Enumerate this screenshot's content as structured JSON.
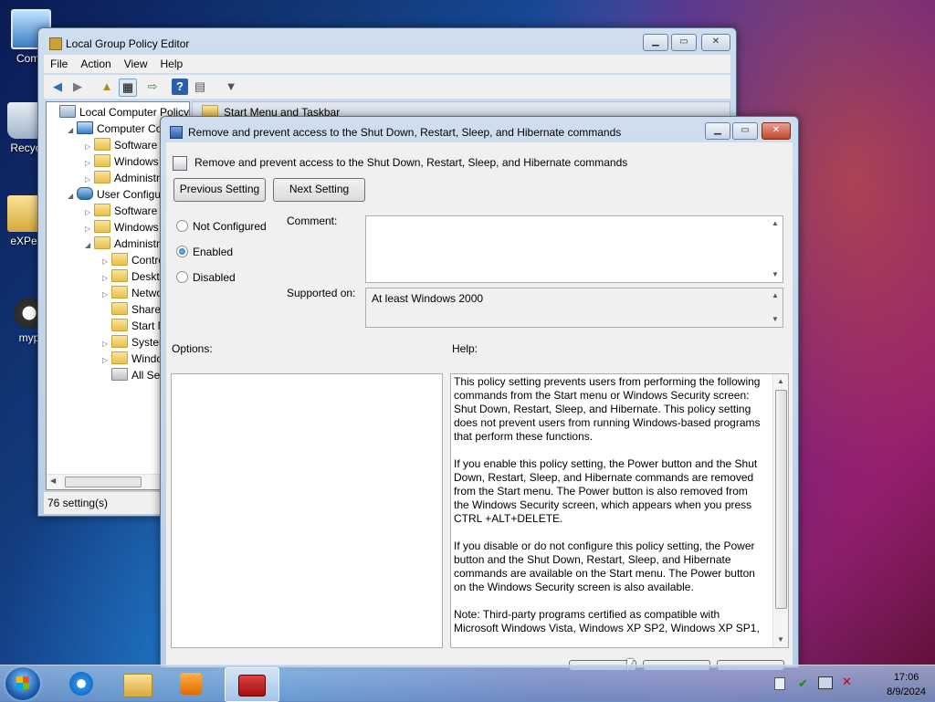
{
  "desktop": {
    "icons": [
      {
        "label": "Comp",
        "name": "computer"
      },
      {
        "label": "Recyc",
        "name": "recycle-bin"
      },
      {
        "label": "eXPer",
        "name": "folder"
      },
      {
        "label": "myp",
        "name": "program-shortcut"
      }
    ]
  },
  "gpedit": {
    "title": "Local Group Policy Editor",
    "menu": [
      "File",
      "Action",
      "View",
      "Help"
    ],
    "tree": [
      {
        "label": "Local Computer Policy",
        "indent": 0,
        "arrow": "",
        "icon": "policy"
      },
      {
        "label": "Computer Conf",
        "indent": 1,
        "arrow": "◢",
        "icon": "computer"
      },
      {
        "label": "Software Set",
        "indent": 2,
        "arrow": "▷",
        "icon": "folder"
      },
      {
        "label": "Windows Se",
        "indent": 2,
        "arrow": "▷",
        "icon": "folder"
      },
      {
        "label": "Administrat",
        "indent": 2,
        "arrow": "▷",
        "icon": "folder"
      },
      {
        "label": "User Configurat",
        "indent": 1,
        "arrow": "◢",
        "icon": "user"
      },
      {
        "label": "Software Set",
        "indent": 2,
        "arrow": "▷",
        "icon": "folder"
      },
      {
        "label": "Windows Se",
        "indent": 2,
        "arrow": "▷",
        "icon": "folder"
      },
      {
        "label": "Administrat",
        "indent": 2,
        "arrow": "◢",
        "icon": "folder"
      },
      {
        "label": "Control",
        "indent": 3,
        "arrow": "▷",
        "icon": "folder"
      },
      {
        "label": "Desktop",
        "indent": 3,
        "arrow": "▷",
        "icon": "folder"
      },
      {
        "label": "Network",
        "indent": 3,
        "arrow": "▷",
        "icon": "folder"
      },
      {
        "label": "Shared F",
        "indent": 3,
        "arrow": "",
        "icon": "folder"
      },
      {
        "label": "Start Me",
        "indent": 3,
        "arrow": "",
        "icon": "folder"
      },
      {
        "label": "System",
        "indent": 3,
        "arrow": "▷",
        "icon": "folder"
      },
      {
        "label": "Window",
        "indent": 3,
        "arrow": "▷",
        "icon": "folder"
      },
      {
        "label": "All Settin",
        "indent": 3,
        "arrow": "",
        "icon": "settings"
      }
    ],
    "right_header": "Start Menu and Taskbar",
    "status": "76 setting(s)"
  },
  "dialog": {
    "title": "Remove and prevent access to the Shut Down, Restart, Sleep, and Hibernate commands",
    "heading": "Remove and prevent access to the Shut Down, Restart, Sleep, and Hibernate commands",
    "prev_button": "Previous Setting",
    "next_button": "Next Setting",
    "radio_not_configured": "Not Configured",
    "radio_enabled": "Enabled",
    "radio_disabled": "Disabled",
    "selected": "Enabled",
    "comment_label": "Comment:",
    "comment_value": "",
    "supported_label": "Supported on:",
    "supported_value": "At least Windows 2000",
    "options_label": "Options:",
    "help_label": "Help:",
    "help_paragraphs": [
      "This policy setting prevents users from performing the following commands from the Start menu or Windows Security screen: Shut Down, Restart, Sleep, and Hibernate. This policy setting does not prevent users from running Windows-based programs that perform these functions.",
      "If you enable this policy setting, the Power button and the Shut Down, Restart, Sleep, and Hibernate commands are removed from the Start menu. The Power button is also removed from the Windows Security screen, which appears when you press CTRL +ALT+DELETE.",
      "If you disable or do not configure this policy setting, the Power button and the Shut Down, Restart, Sleep, and Hibernate commands are available on the Start menu. The Power button on the Windows Security screen is also available.",
      "Note: Third-party programs certified as compatible with Microsoft Windows Vista, Windows XP SP2, Windows XP SP1,"
    ]
  },
  "taskbar": {
    "apps": [
      "internet-explorer",
      "file-explorer",
      "media-player",
      "group-policy-toolbox"
    ],
    "time": "17:06",
    "date": "8/9/2024"
  },
  "colors": {
    "accent": "#1e5fa8",
    "close": "#c2442c"
  }
}
